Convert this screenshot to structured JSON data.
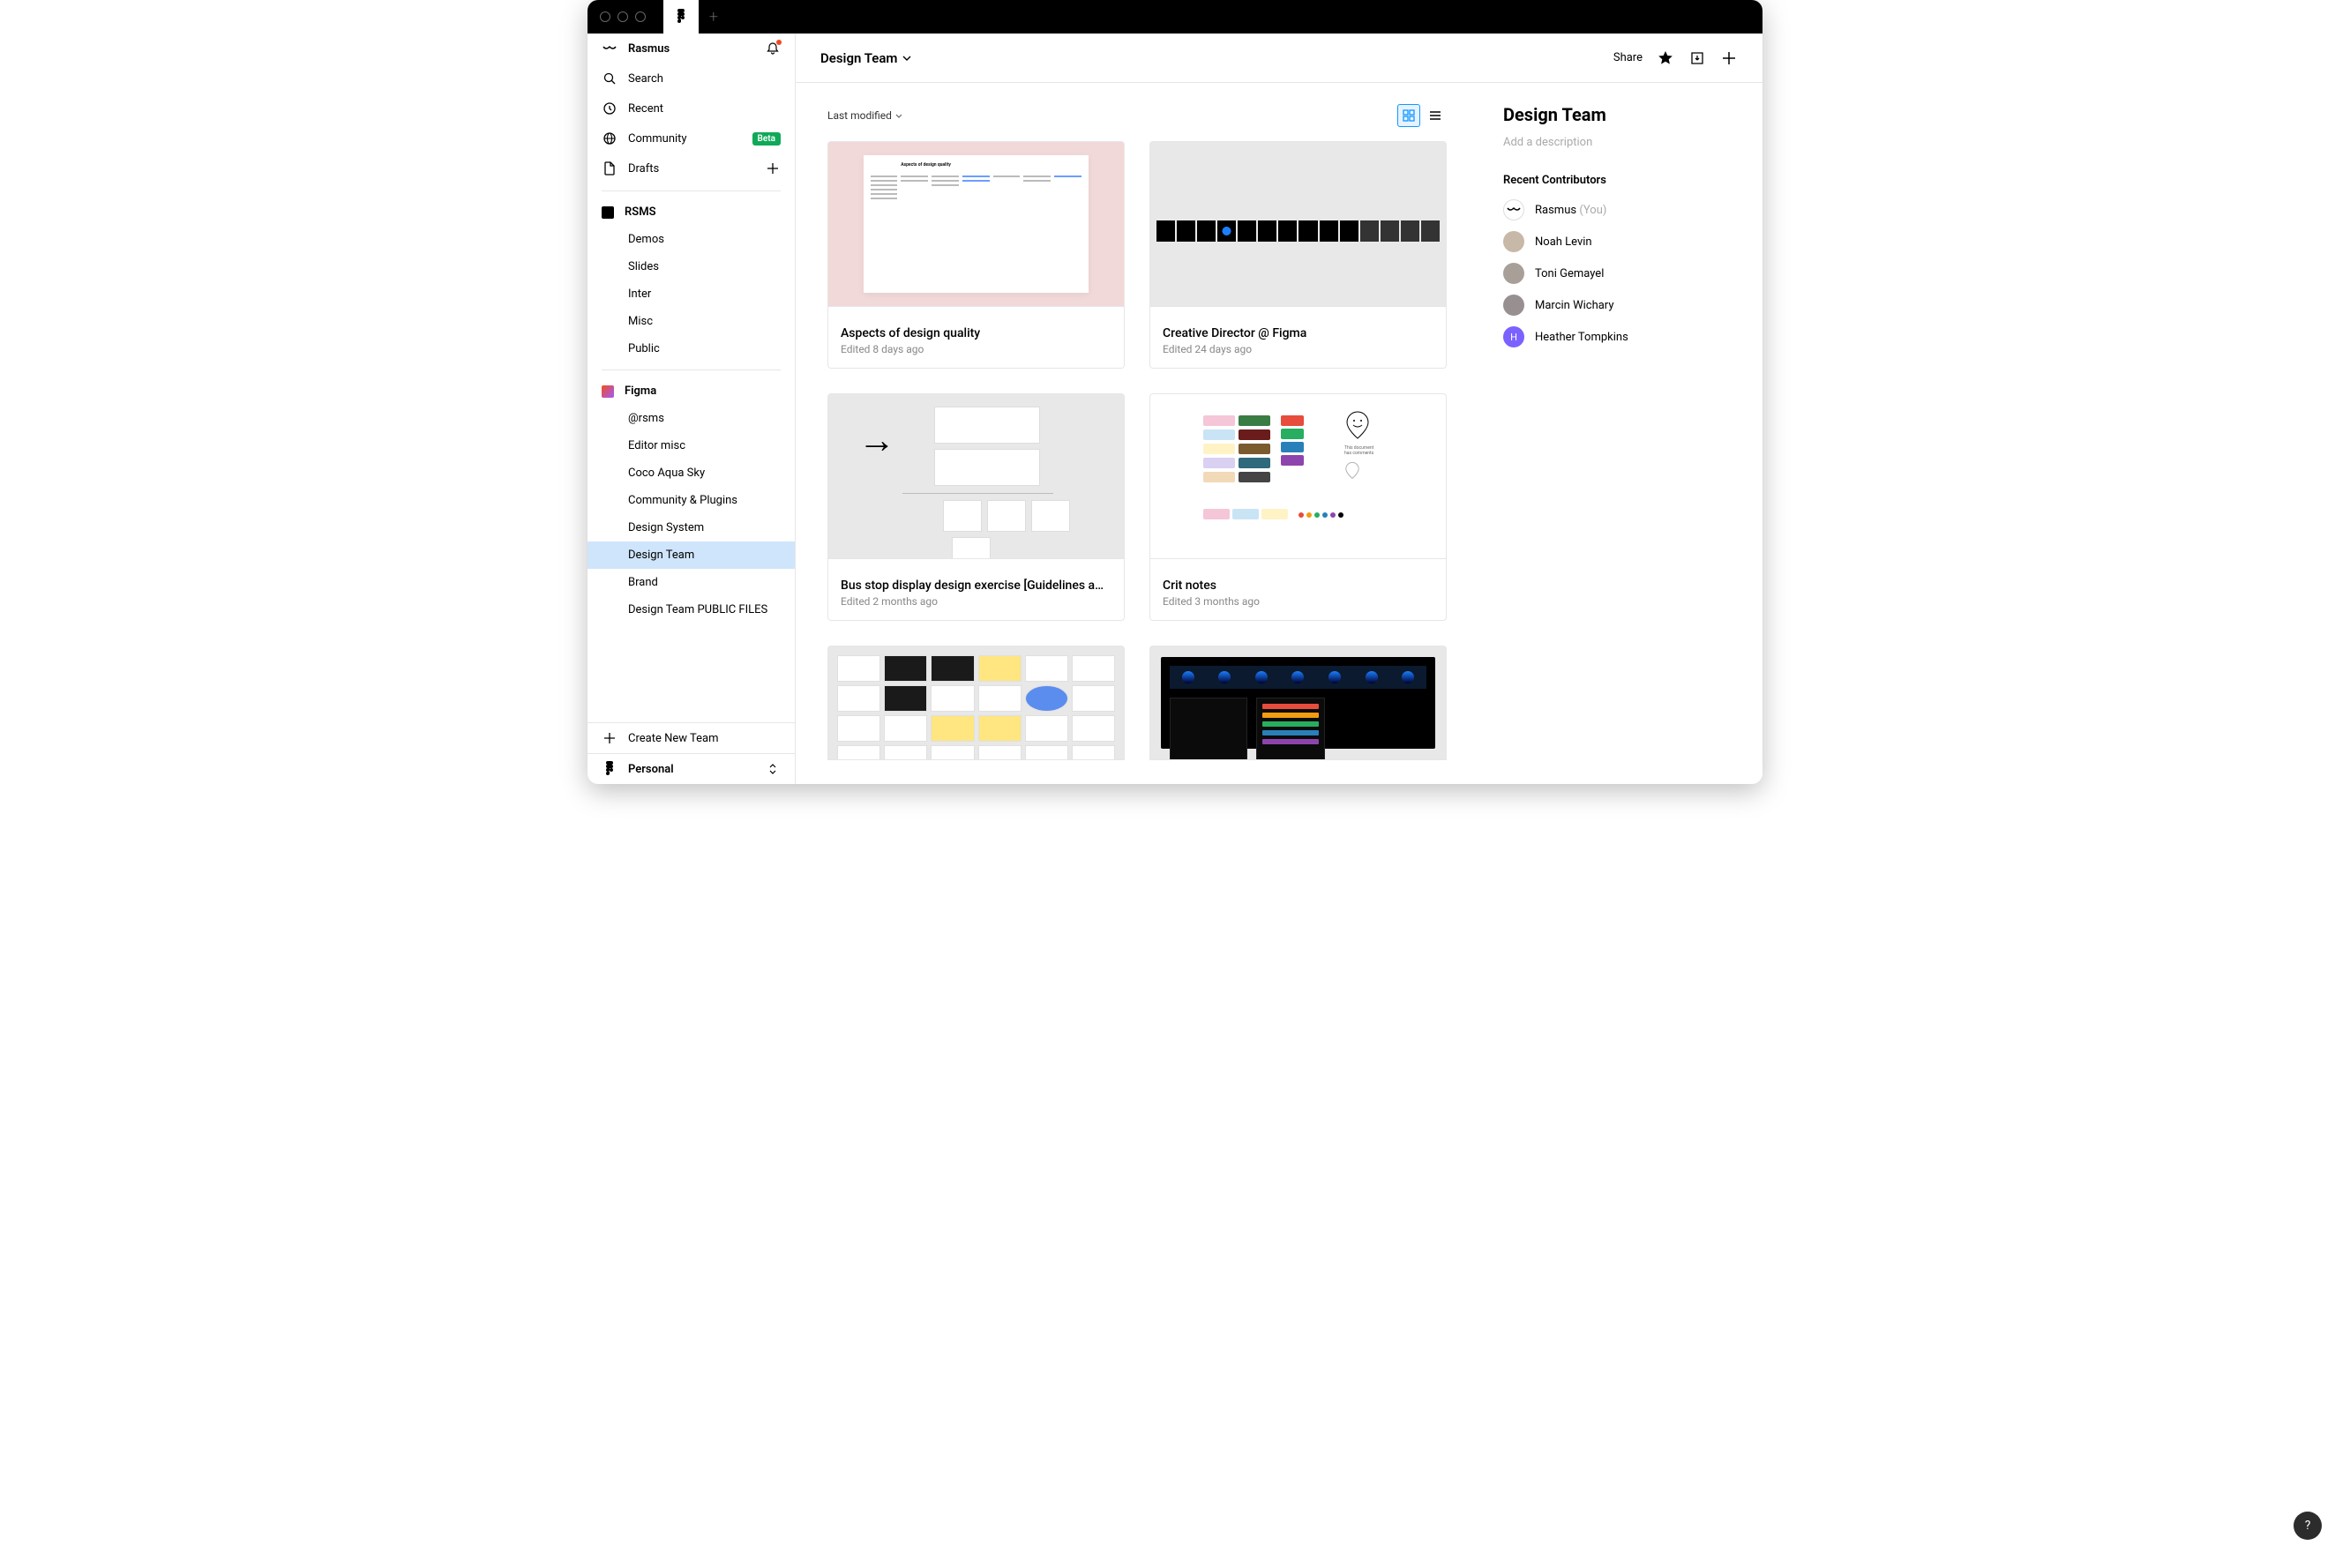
{
  "titlebar": {
    "tabs": [
      "figma"
    ]
  },
  "sidebar": {
    "user": "Rasmus",
    "search": "Search",
    "recent": "Recent",
    "community": "Community",
    "communityBadge": "Beta",
    "drafts": "Drafts",
    "teams": [
      {
        "name": "RSMS",
        "iconColor": "#000",
        "projects": [
          "Demos",
          "Slides",
          "Inter",
          "Misc",
          "Public"
        ]
      },
      {
        "name": "Figma",
        "iconColor": "#0d0d0d",
        "projects": [
          "@rsms",
          "Editor misc",
          "Coco Aqua Sky",
          "Community & Plugins",
          "Design System",
          "Design Team",
          "Brand",
          "Design Team PUBLIC FILES"
        ]
      }
    ],
    "createTeam": "Create New Team",
    "plan": "Personal"
  },
  "header": {
    "title": "Design Team",
    "share": "Share"
  },
  "files": {
    "sortLabel": "Last modified",
    "cards": [
      {
        "title": "Aspects of design quality",
        "meta": "Edited 8 days ago",
        "thumb": "pink"
      },
      {
        "title": "Creative Director @ Figma",
        "meta": "Edited 24 days ago",
        "thumb": "strip"
      },
      {
        "title": "Bus stop display design exercise [Guidelines a…",
        "meta": "Edited 2 months ago",
        "thumb": "arrow"
      },
      {
        "title": "Crit notes",
        "meta": "Edited 3 months ago",
        "thumb": "swatch"
      },
      {
        "title": "",
        "meta": "",
        "thumb": "collage"
      },
      {
        "title": "",
        "meta": "",
        "thumb": "dark"
      }
    ]
  },
  "rightpanel": {
    "title": "Design Team",
    "addDesc": "Add a description",
    "contribTitle": "Recent Contributors",
    "contributors": [
      {
        "name": "Rasmus",
        "you": "(You)",
        "avatarType": "eye",
        "avatarBg": "#fff"
      },
      {
        "name": "Noah Levin",
        "avatarType": "photo",
        "avatarBg": "#c8b8a8"
      },
      {
        "name": "Toni Gemayel",
        "avatarType": "photo",
        "avatarBg": "#a8a098"
      },
      {
        "name": "Marcin Wichary",
        "avatarType": "photo",
        "avatarBg": "#989090"
      },
      {
        "name": "Heather Tompkins",
        "avatarType": "letter",
        "avatarLetter": "H",
        "avatarBg": "#7b61ff"
      }
    ]
  },
  "help": "?"
}
